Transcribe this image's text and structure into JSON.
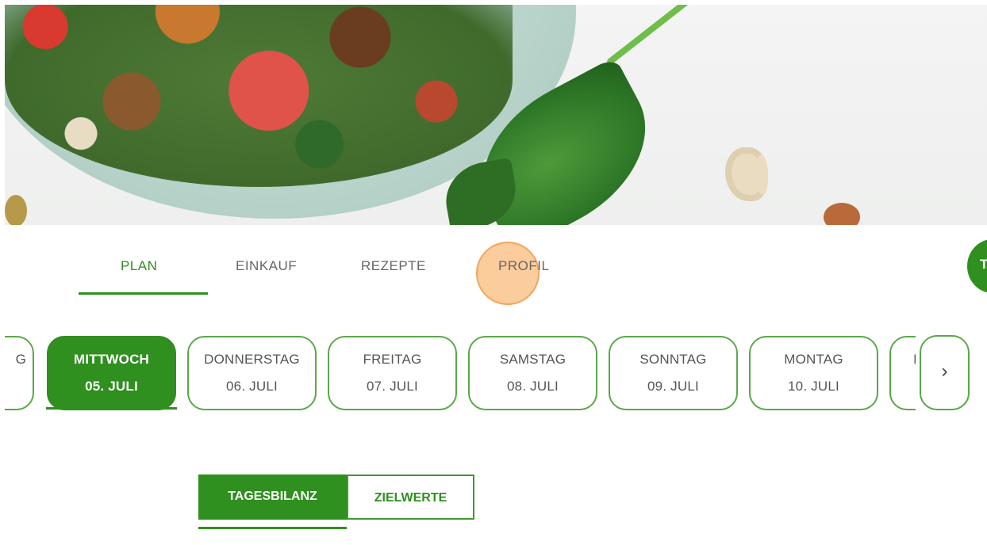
{
  "nav": {
    "items": [
      {
        "label": "PLAN",
        "active": true
      },
      {
        "label": "EINKAUF",
        "active": false
      },
      {
        "label": "REZEPTE",
        "active": false
      },
      {
        "label": "PROFIL",
        "active": false
      }
    ],
    "avatar_letter": "T"
  },
  "days": {
    "items": [
      {
        "name": "G",
        "date": "",
        "active": false,
        "partial": "left"
      },
      {
        "name": "MITTWOCH",
        "date": "05. JULI",
        "active": true
      },
      {
        "name": "DONNERSTAG",
        "date": "06. JULI",
        "active": false
      },
      {
        "name": "FREITAG",
        "date": "07. JULI",
        "active": false
      },
      {
        "name": "SAMSTAG",
        "date": "08. JULI",
        "active": false
      },
      {
        "name": "SONNTAG",
        "date": "09. JULI",
        "active": false
      },
      {
        "name": "MONTAG",
        "date": "10. JULI",
        "active": false
      },
      {
        "name": "I",
        "date": "",
        "active": false,
        "partial": "right"
      }
    ],
    "next_icon": "chevron-right-icon",
    "next_glyph": "›"
  },
  "summary_tabs": [
    {
      "label": "TAGESBILANZ",
      "active": true
    },
    {
      "label": "ZIELWERTE",
      "active": false
    }
  ],
  "colors": {
    "accent": "#2f8f1f",
    "card_border": "#5aa84a",
    "click_indicator": "#f9aa5a"
  }
}
